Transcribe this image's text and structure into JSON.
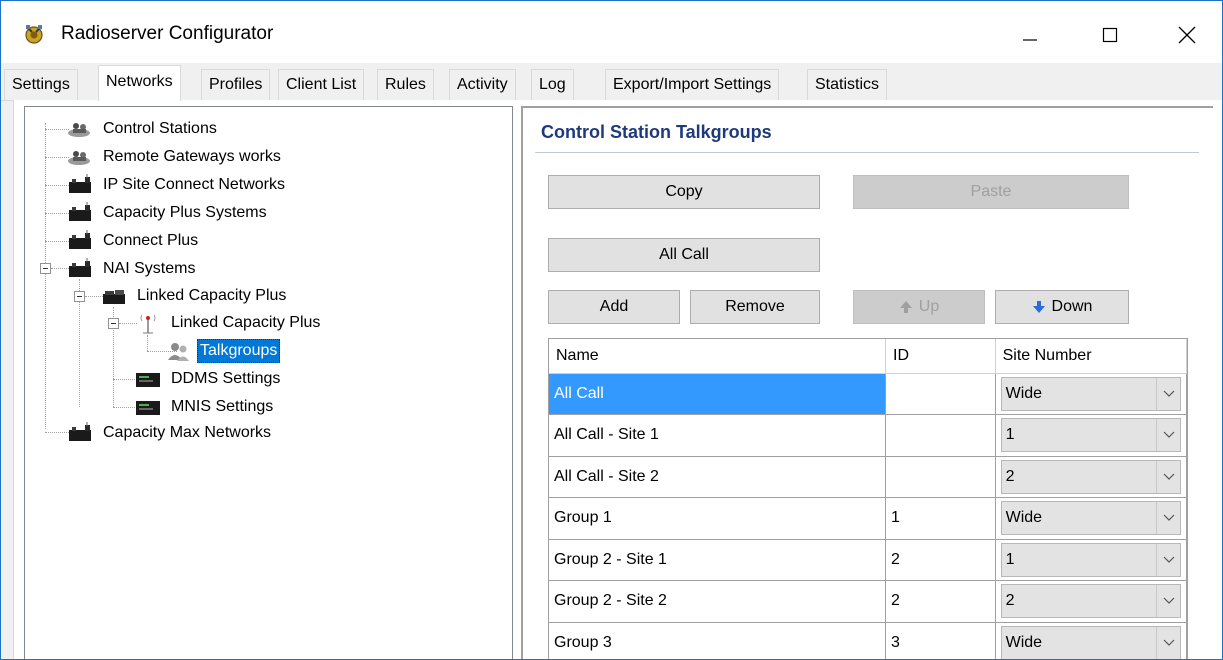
{
  "window": {
    "title": "Radioserver Configurator",
    "icon": "radioserver-app-icon"
  },
  "tabs": [
    {
      "label": "Settings",
      "active": false
    },
    {
      "label": "Networks",
      "active": true
    },
    {
      "label": "Profiles",
      "active": false
    },
    {
      "label": "Client List",
      "active": false
    },
    {
      "label": "Rules",
      "active": false
    },
    {
      "label": "Activity",
      "active": false
    },
    {
      "label": "Log",
      "active": false
    },
    {
      "label": "Export/Import Settings",
      "active": false
    },
    {
      "label": "Statistics",
      "active": false
    }
  ],
  "tree": {
    "items": [
      {
        "label": "Control Stations",
        "icon": "control-stations-icon"
      },
      {
        "label": "Remote Gateways  works",
        "icon": "remote-gateways-icon"
      },
      {
        "label": "IP Site Connect Networks",
        "icon": "repeater-icon"
      },
      {
        "label": "Capacity Plus Systems",
        "icon": "repeater-icon"
      },
      {
        "label": "Connect Plus",
        "icon": "repeater-icon"
      },
      {
        "label": "NAI Systems",
        "icon": "repeater-icon",
        "expanded": true
      },
      {
        "label": "Linked Capacity Plus",
        "icon": "repeater-icon",
        "expanded": true
      },
      {
        "label": "Linked Capacity Plus",
        "icon": "antenna-icon",
        "expanded": true
      },
      {
        "label": "Talkgroups",
        "icon": "talkgroups-icon",
        "selected": true
      },
      {
        "label": "DDMS Settings",
        "icon": "server-icon"
      },
      {
        "label": "MNIS Settings",
        "icon": "server-icon"
      },
      {
        "label": "Capacity Max Networks",
        "icon": "repeater-icon"
      }
    ]
  },
  "panel": {
    "title": "Control Station Talkgroups",
    "buttons": {
      "copy": "Copy",
      "paste": "Paste",
      "all_call": "All Call",
      "add": "Add",
      "remove": "Remove",
      "up": "Up",
      "down": "Down"
    },
    "grid": {
      "columns": [
        "Name",
        "ID",
        "Site Number"
      ],
      "rows": [
        {
          "name": "All Call",
          "id": "",
          "site": "Wide",
          "selected": true
        },
        {
          "name": "All Call - Site 1",
          "id": "",
          "site": "1"
        },
        {
          "name": "All Call - Site 2",
          "id": "",
          "site": "2"
        },
        {
          "name": "Group 1",
          "id": "1",
          "site": "Wide"
        },
        {
          "name": "Group 2 - Site 1",
          "id": "2",
          "site": "1"
        },
        {
          "name": "Group 2 - Site 2",
          "id": "2",
          "site": "2"
        },
        {
          "name": "Group 3",
          "id": "3",
          "site": "Wide"
        }
      ]
    }
  },
  "colors": {
    "accent": "#0078d7",
    "selected_cell": "#3399ff",
    "section_title": "#1f3a7a"
  }
}
